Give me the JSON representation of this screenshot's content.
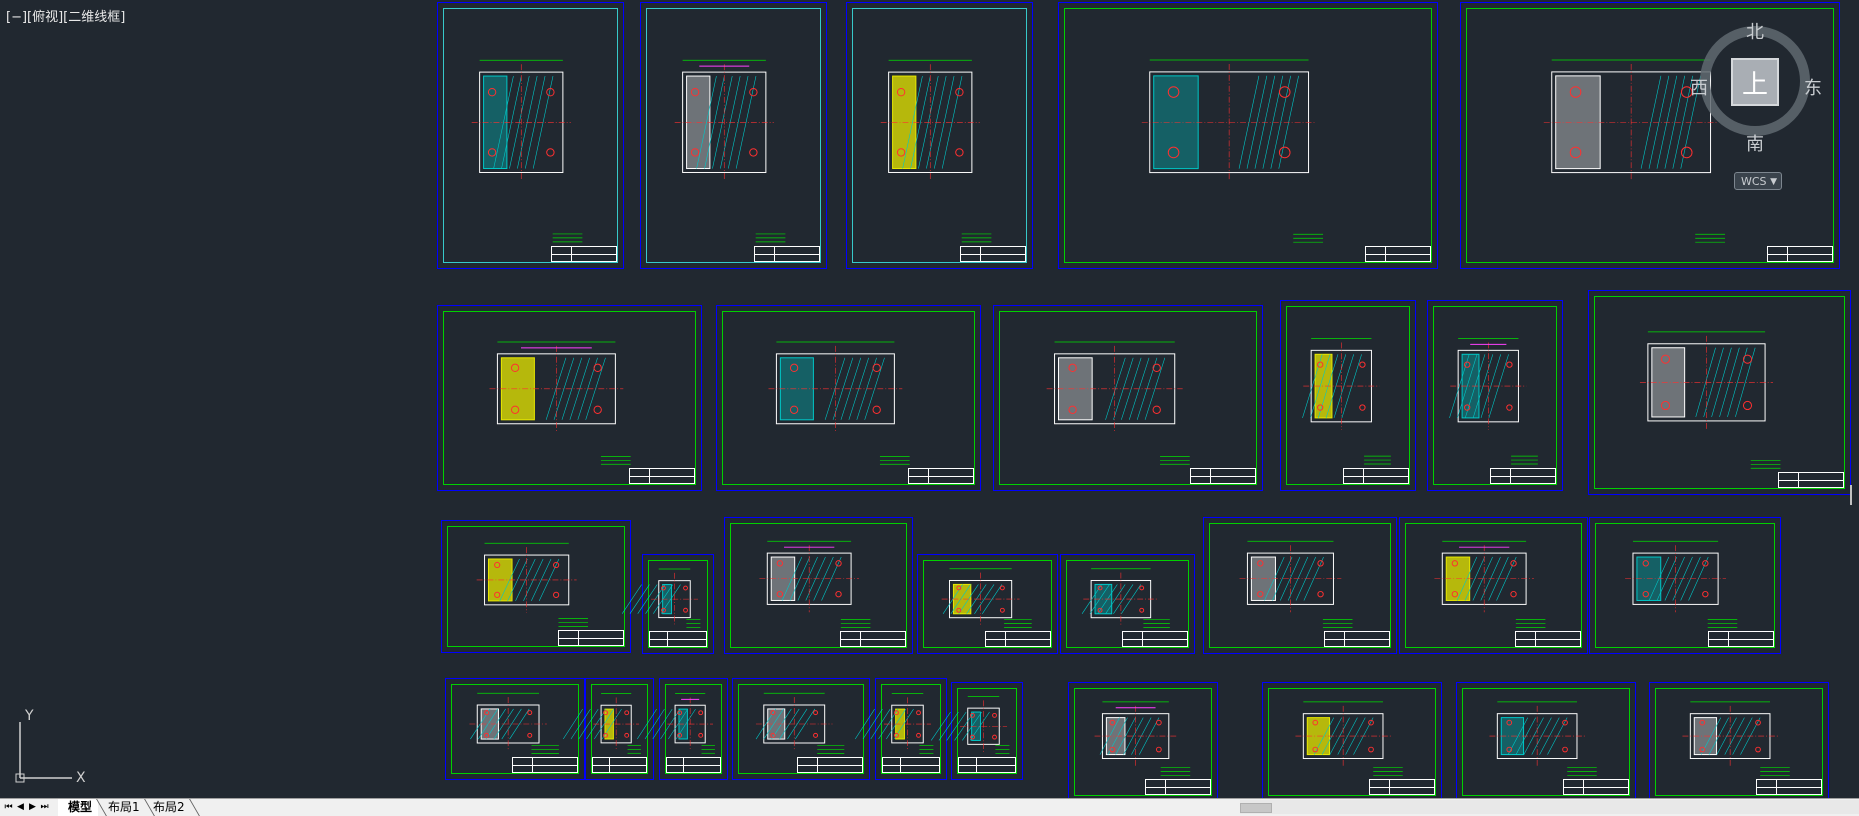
{
  "viewport": {
    "label": "[−][俯视][二维线框]"
  },
  "viewcube": {
    "top_face": "上",
    "north": "北",
    "south": "南",
    "east": "东",
    "west": "西",
    "wcs_label": "WCS",
    "wcs_caret": "▼"
  },
  "ucs": {
    "x_label": "X",
    "y_label": "Y"
  },
  "nav_buttons": [
    "⏮",
    "◀",
    "▶",
    "⏭"
  ],
  "tabs": [
    {
      "label": "模型",
      "active": true
    },
    {
      "label": "布局1",
      "active": false
    },
    {
      "label": "布局2",
      "active": false
    }
  ],
  "colors": {
    "background": "#212830",
    "sheet_border": "#0000ff",
    "frame_green": "#00d000",
    "frame_cyan": "#37c9c9",
    "geometry_white": "#ffffff",
    "hatch_cyan": "#00c8c8",
    "hatch_yellow": "#e8e800",
    "centerline_red": "#ff3030",
    "dimension_green": "#00e000",
    "magenta": "#ff40ff"
  }
}
